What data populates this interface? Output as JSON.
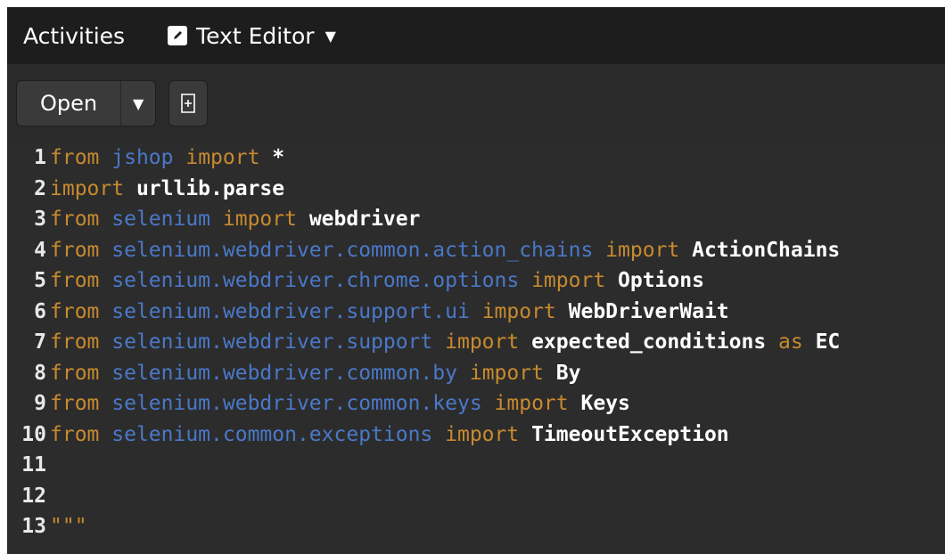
{
  "topbar": {
    "activities": "Activities",
    "app_name": "Text Editor",
    "dropdown_glyph": "▼"
  },
  "toolbar": {
    "open_label": "Open",
    "open_arrow": "▼",
    "new_document_icon": "new-document-icon"
  },
  "colors": {
    "keyword": "#c88a2e",
    "module": "#4a78c8",
    "text": "#ffffff",
    "background": "#2c2c2c"
  },
  "editor": {
    "lines": [
      {
        "n": "1",
        "parts": [
          {
            "t": "from",
            "c": "kw"
          },
          {
            "t": " "
          },
          {
            "t": "jshop",
            "c": "mod"
          },
          {
            "t": " "
          },
          {
            "t": "import",
            "c": "kw"
          },
          {
            "t": " *"
          }
        ]
      },
      {
        "n": "2",
        "parts": [
          {
            "t": "import",
            "c": "kw"
          },
          {
            "t": " urllib.parse"
          }
        ]
      },
      {
        "n": "3",
        "parts": [
          {
            "t": "from",
            "c": "kw"
          },
          {
            "t": " "
          },
          {
            "t": "selenium",
            "c": "mod"
          },
          {
            "t": " "
          },
          {
            "t": "import",
            "c": "kw"
          },
          {
            "t": " webdriver"
          }
        ]
      },
      {
        "n": "4",
        "parts": [
          {
            "t": "from",
            "c": "kw"
          },
          {
            "t": " "
          },
          {
            "t": "selenium.webdriver.common.action_chains",
            "c": "mod"
          },
          {
            "t": " "
          },
          {
            "t": "import",
            "c": "kw"
          },
          {
            "t": " ActionChains"
          }
        ]
      },
      {
        "n": "5",
        "parts": [
          {
            "t": "from",
            "c": "kw"
          },
          {
            "t": " "
          },
          {
            "t": "selenium.webdriver.chrome.options",
            "c": "mod"
          },
          {
            "t": " "
          },
          {
            "t": "import",
            "c": "kw"
          },
          {
            "t": " Options"
          }
        ]
      },
      {
        "n": "6",
        "parts": [
          {
            "t": "from",
            "c": "kw"
          },
          {
            "t": " "
          },
          {
            "t": "selenium.webdriver.support.ui",
            "c": "mod"
          },
          {
            "t": " "
          },
          {
            "t": "import",
            "c": "kw"
          },
          {
            "t": " WebDriverWait"
          }
        ]
      },
      {
        "n": "7",
        "parts": [
          {
            "t": "from",
            "c": "kw"
          },
          {
            "t": " "
          },
          {
            "t": "selenium.webdriver.support",
            "c": "mod"
          },
          {
            "t": " "
          },
          {
            "t": "import",
            "c": "kw"
          },
          {
            "t": " expected_conditions "
          },
          {
            "t": "as",
            "c": "kw"
          },
          {
            "t": " EC"
          }
        ]
      },
      {
        "n": "8",
        "parts": [
          {
            "t": "from",
            "c": "kw"
          },
          {
            "t": " "
          },
          {
            "t": "selenium.webdriver.common.by",
            "c": "mod"
          },
          {
            "t": " "
          },
          {
            "t": "import",
            "c": "kw"
          },
          {
            "t": " By"
          }
        ]
      },
      {
        "n": "9",
        "parts": [
          {
            "t": "from",
            "c": "kw"
          },
          {
            "t": " "
          },
          {
            "t": "selenium.webdriver.common.keys",
            "c": "mod"
          },
          {
            "t": " "
          },
          {
            "t": "import",
            "c": "kw"
          },
          {
            "t": " Keys"
          }
        ]
      },
      {
        "n": "10",
        "parts": [
          {
            "t": "from",
            "c": "kw"
          },
          {
            "t": " "
          },
          {
            "t": "selenium.common.exceptions",
            "c": "mod"
          },
          {
            "t": " "
          },
          {
            "t": "import",
            "c": "kw"
          },
          {
            "t": " TimeoutException"
          }
        ]
      },
      {
        "n": "11",
        "parts": []
      },
      {
        "n": "12",
        "parts": []
      },
      {
        "n": "13",
        "parts": [
          {
            "t": "\"\"\"",
            "c": "str"
          }
        ]
      }
    ]
  }
}
